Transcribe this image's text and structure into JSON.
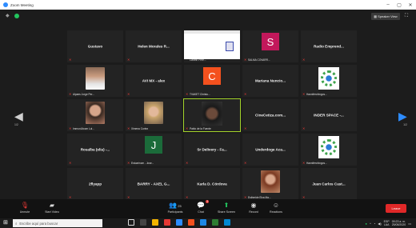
{
  "window": {
    "title": "Zoom Meeting",
    "minimize": "–",
    "maximize": "▢",
    "close": "✕"
  },
  "topbar": {
    "speaker_view_label": "Speaker View"
  },
  "navigation": {
    "left_page": "1/2",
    "right_page": "1/2"
  },
  "tiles": [
    {
      "name": "Gustavo",
      "label": ""
    },
    {
      "name": "Helen Morales R...",
      "label": ""
    },
    {
      "name": "",
      "label": "Lizbeth Pere..."
    },
    {
      "name": "S",
      "label": "SALMA COVARR..."
    },
    {
      "name": "Radio Emprend...",
      "label": ""
    },
    {
      "name": "",
      "label": "Alpaes Jorge Per..."
    },
    {
      "name": "AVI MX - alex",
      "label": ""
    },
    {
      "name": "C",
      "label": "TVAKET Christo..."
    },
    {
      "name": "Mariana Nuncio...",
      "label": ""
    },
    {
      "name": "",
      "label": "Hanniferchingos..."
    },
    {
      "name": "",
      "label": "ImmunUtoom Lui..."
    },
    {
      "name": "",
      "label": "Ximena Cortez"
    },
    {
      "name": "",
      "label": "Pablo de la Fuente"
    },
    {
      "name": "CineCetiza.com...",
      "label": ""
    },
    {
      "name": "INDER SPACE -...",
      "label": ""
    },
    {
      "name": "Rosalba (elia) -...",
      "label": ""
    },
    {
      "name": "J",
      "label": "Estuarinom - Jose..."
    },
    {
      "name": "Sr Delivery - Fa...",
      "label": ""
    },
    {
      "name": "Underdoge Aca...",
      "label": ""
    },
    {
      "name": "",
      "label": "Hanniferchingos..."
    },
    {
      "name": "2flyapp",
      "label": ""
    },
    {
      "name": "BARRY - AXEL G...",
      "label": ""
    },
    {
      "name": "Karla D. Córdova",
      "label": ""
    },
    {
      "name": "",
      "label": "Estheride Elva Ma..."
    },
    {
      "name": "Juan Carlos Cast...",
      "label": ""
    }
  ],
  "toolbar": {
    "unmute_label": "Unmute",
    "start_video_label": "Start Video",
    "participants_label": "Participants",
    "participants_count": "25",
    "chat_label": "Chat",
    "chat_badge": "3",
    "share_screen_label": "Share Screen",
    "record_label": "Record",
    "reactions_label": "Reactions",
    "leave_label": "Leave"
  },
  "taskbar": {
    "search_placeholder": "Escribe aquí para buscar",
    "lang_top": "ESP",
    "lang_bottom": "LAA",
    "time": "09:23 a. m.",
    "date": "25/08/2020"
  },
  "colors": {
    "meeting_bg": "#1c1c1c",
    "active_speaker": "#a3d32a",
    "avatar_s": "#c2185b",
    "avatar_c": "#f4511e",
    "avatar_j": "#1b6b3a",
    "zoom_blue": "#2d8cff",
    "leave_red": "#e02828"
  }
}
